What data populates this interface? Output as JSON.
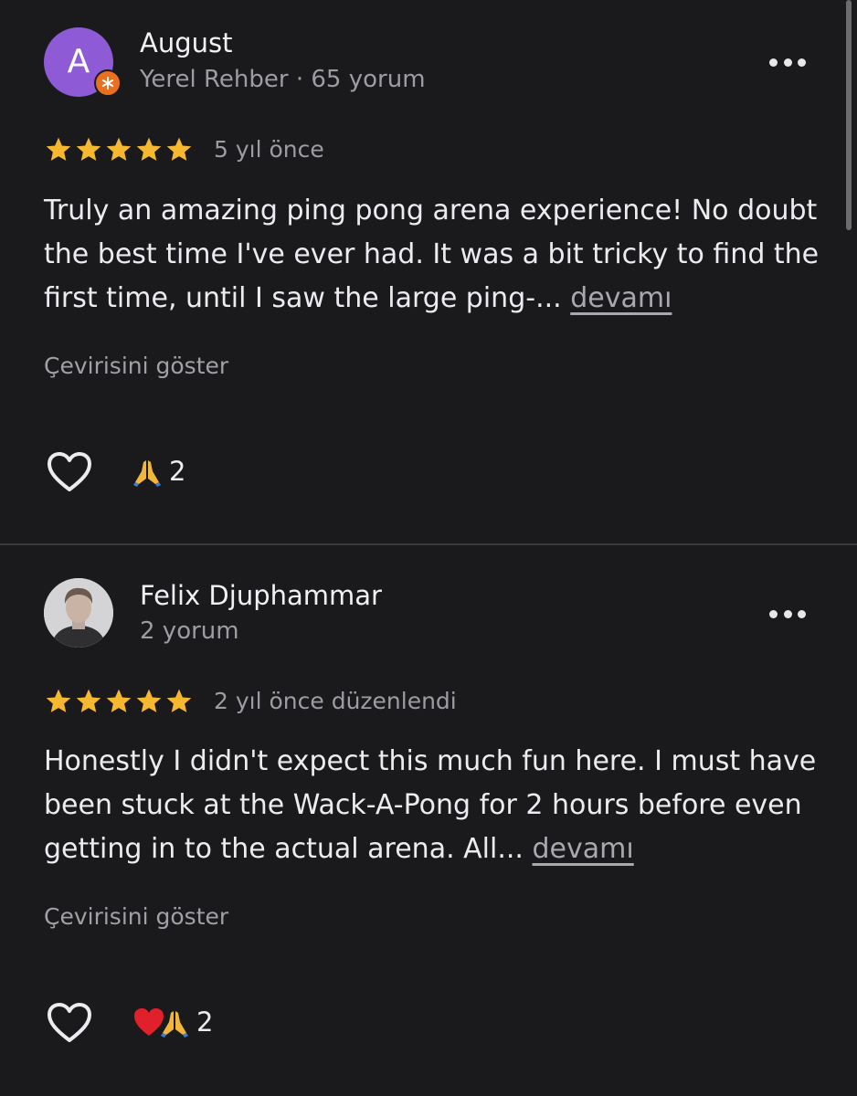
{
  "reviews": [
    {
      "avatar_letter": "A",
      "author": "August",
      "meta": "Yerel Rehber · 65 yorum",
      "rating": 5,
      "date": "5 yıl önce",
      "text": "Truly an amazing ping pong arena experience! No doubt the best time I've ever had. It was a bit tricky to find the first time, until I saw the large ping-...",
      "more_label": "devamı",
      "translate_label": "Çevirisini göster",
      "reaction_count": "2",
      "reactions": [
        "folded-hands"
      ]
    },
    {
      "author": "Felix Djuphammar",
      "meta": "2 yorum",
      "rating": 5,
      "date": "2 yıl önce düzenlendi",
      "text": "Honestly I didn't expect this much fun here. I must have been stuck at the Wack-A-Pong for 2 hours before even getting in to the actual arena. All...",
      "more_label": "devamı",
      "translate_label": "Çevirisini göster",
      "reaction_count": "2",
      "reactions": [
        "red-heart",
        "folded-hands"
      ]
    }
  ],
  "colors": {
    "background": "#1a1a1c",
    "star": "#f5b82e",
    "avatar_purple": "#8e5ad6",
    "local_guide_badge": "#e8701f"
  }
}
